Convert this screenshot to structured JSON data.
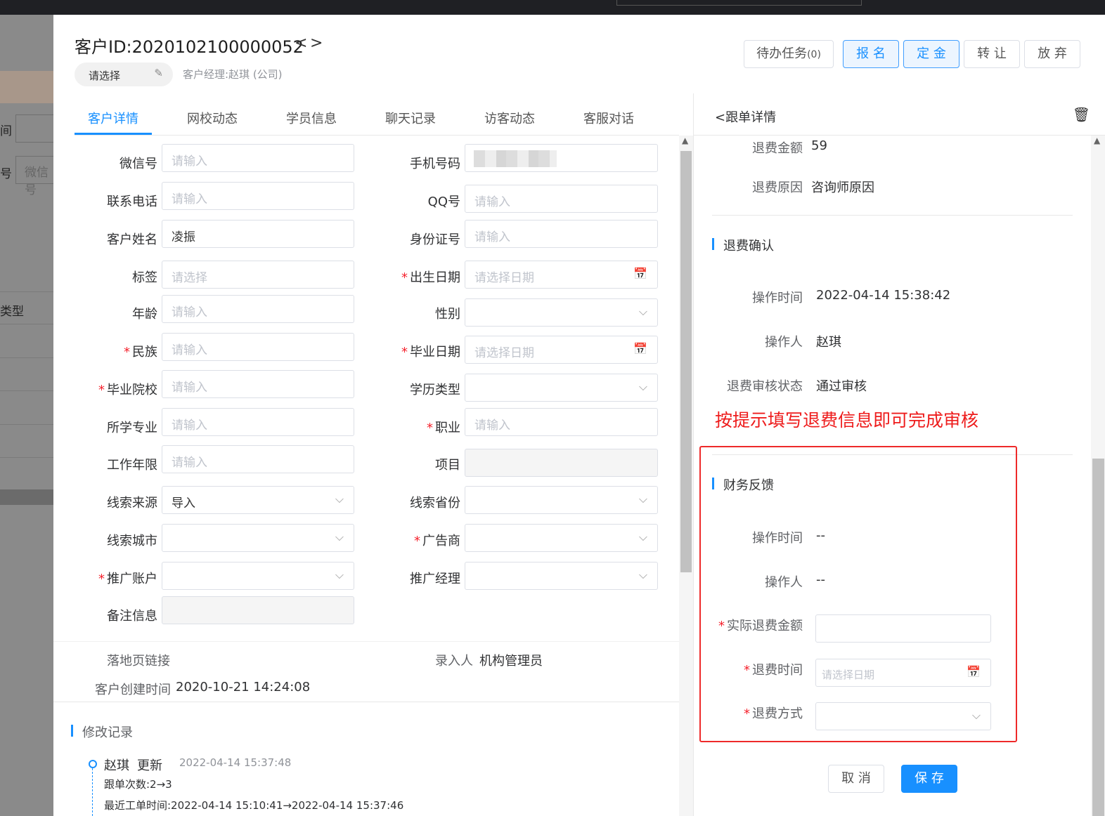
{
  "background": {
    "labels": [
      "间",
      "号",
      "类型"
    ],
    "input_text": "微信号"
  },
  "header": {
    "title": "客户ID:2020102100000052",
    "prev": "<",
    "next": ">",
    "status_select": "请选择",
    "manager": "客户经理:赵琪 (公司)",
    "buttons": {
      "todo": "待办任务",
      "todo_count": "(0)",
      "register": "报 名",
      "deposit": "定 金",
      "transfer": "转 让",
      "abandon": "放 弃"
    }
  },
  "tabs": [
    "客户详情",
    "网校动态",
    "学员信息",
    "聊天记录",
    "访客动态",
    "客服对话"
  ],
  "form": {
    "wechat": {
      "label": "微信号",
      "placeholder": "请输入"
    },
    "phone": {
      "label": "手机号码"
    },
    "contact_phone": {
      "label": "联系电话",
      "placeholder": "请输入"
    },
    "qq": {
      "label": "QQ号",
      "placeholder": "请输入"
    },
    "name": {
      "label": "客户姓名",
      "value": "凌振"
    },
    "id_card": {
      "label": "身份证号",
      "placeholder": "请输入"
    },
    "tag": {
      "label": "标签",
      "placeholder": "请选择"
    },
    "birthday": {
      "label": "出生日期",
      "placeholder": "请选择日期"
    },
    "age": {
      "label": "年龄",
      "placeholder": "请输入"
    },
    "gender": {
      "label": "性别"
    },
    "ethnicity": {
      "label": "民族",
      "placeholder": "请输入"
    },
    "grad_date": {
      "label": "毕业日期",
      "placeholder": "请选择日期"
    },
    "school": {
      "label": "毕业院校",
      "placeholder": "请输入"
    },
    "edu_type": {
      "label": "学历类型"
    },
    "major": {
      "label": "所学专业",
      "placeholder": "请输入"
    },
    "job": {
      "label": "职业",
      "placeholder": "请输入"
    },
    "work_years": {
      "label": "工作年限",
      "placeholder": "请输入"
    },
    "project": {
      "label": "项目"
    },
    "lead_source": {
      "label": "线索来源",
      "value": "导入"
    },
    "lead_province": {
      "label": "线索省份"
    },
    "lead_city": {
      "label": "线索城市"
    },
    "advertiser": {
      "label": "广告商"
    },
    "promo_account": {
      "label": "推广账户"
    },
    "promo_manager": {
      "label": "推广经理"
    },
    "remark": {
      "label": "备注信息"
    }
  },
  "info": {
    "landing_label": "落地页链接",
    "recorder_label": "录入人",
    "recorder_value": "机构管理员",
    "created_label": "客户创建时间",
    "created_value": "2020-10-21 14:24:08"
  },
  "history": {
    "title": "修改记录",
    "entry": {
      "user": "赵琪",
      "action": "更新",
      "time": "2022-04-14 15:37:48",
      "line1": "跟单次数:2→3",
      "line2": "最近工单时间:2022-04-14 15:10:41→2022-04-14 15:37:46"
    }
  },
  "detail": {
    "back_label": "跟单详情",
    "refund_amount_label": "退费金额",
    "refund_amount": "59",
    "refund_reason_label": "退费原因",
    "refund_reason": "咨询师原因",
    "confirm_title": "退费确认",
    "op_time_label": "操作时间",
    "op_time": "2022-04-14 15:38:42",
    "operator_label": "操作人",
    "operator": "赵琪",
    "audit_label": "退费审核状态",
    "audit": "通过审核",
    "hint": "按提示填写退费信息即可完成审核",
    "finance_title": "财务反馈",
    "fin_op_time_label": "操作时间",
    "fin_op_time": "--",
    "fin_operator_label": "操作人",
    "fin_operator": "--",
    "actual_amount_label": "实际退费金额",
    "refund_time_label": "退费时间",
    "refund_time_placeholder": "请选择日期",
    "refund_method_label": "退费方式",
    "cancel": "取 消",
    "save": "保 存"
  },
  "icons": {
    "edit": "✎",
    "calendar": "📅",
    "chevron": "⌵",
    "trash": "🗑",
    "back": "<"
  }
}
